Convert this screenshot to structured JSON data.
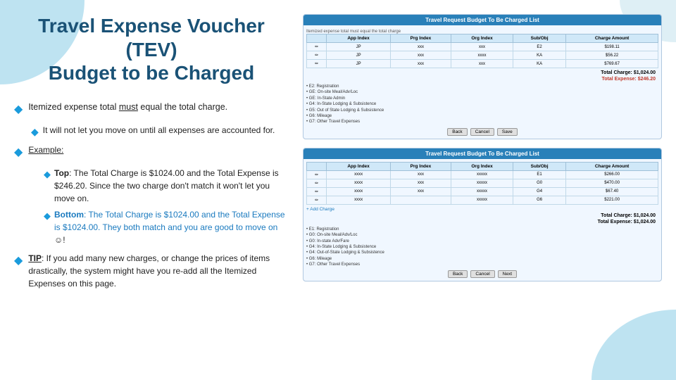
{
  "page": {
    "title_line1": "Travel Expense Voucher (TEV)",
    "title_line2": "Budget to be Charged"
  },
  "content": {
    "bullet1": "Itemized expense total must equal the total charge.",
    "sub1": "It will not let you move on until all expenses are accounted for.",
    "bullet2_label": "Example:",
    "top_label": "Top",
    "top_text": ": The Total Charge is $1024.00 and the Total Expense is $246.20.  Since the two charge don't match it won't let you move on.",
    "bottom_label": "Bottom",
    "bottom_text": ": The Total Charge is $1024.00 and the Total Expense is $1024.00.  They both match and you are good to move on",
    "smiley": "☺",
    "tip_label": "TIP",
    "tip_text": ": If you add many new charges, or change the prices of items drastically, the system might have you re-add all the Itemized Expenses on this page."
  },
  "panel_top": {
    "title": "Travel Request Budget To Be Charged List",
    "note": "Itemized expense total must equal the total charge",
    "columns": [
      "",
      "App Index",
      "Prg Index",
      "Org Index",
      "Sub/Obj",
      "Charge Amount"
    ],
    "rows": [
      [
        "✏",
        "JP",
        "xxx",
        "xxx",
        "E2",
        "$198.11"
      ],
      [
        "✏",
        "JP",
        "xxx",
        "xxxx",
        "KA",
        "$56.22"
      ],
      [
        "✏",
        "JP",
        "xxx",
        "xxx",
        "KA",
        "$769.67"
      ]
    ],
    "total_label": "Total Charge",
    "total_amount": "$1,024.00",
    "expense_label": "Total Expense:",
    "expense_amount": "$246.20",
    "legend_items": [
      "E2: Registration",
      "GE: On-site Meal/Adv/Loc",
      "GE: In-State Admin",
      "G4: In-State Lodging & Subsistence",
      "G5: Out of State Lodging & Subsistence",
      "G6: Mileage",
      "G7: Other Travel Expenses"
    ],
    "buttons": [
      "Back",
      "Cancel",
      "Save"
    ]
  },
  "panel_bottom": {
    "title": "Travel Request Budget To Be Charged List",
    "columns": [
      "",
      "App Index",
      "Prg Index",
      "Org Index",
      "Sub/Obj",
      "Charge Amount"
    ],
    "rows": [
      [
        "✏",
        "xxxx",
        "xxx",
        "xxxxx",
        "E1",
        "$266.00"
      ],
      [
        "✏",
        "xxxx",
        "xxx",
        "xxxxx",
        "G0",
        "$470.00"
      ],
      [
        "✏",
        "xxxx",
        "xxx",
        "xxxxx",
        "G4",
        "$67.40"
      ],
      [
        "✏",
        "xxxx",
        "xxxxx",
        "G6",
        "$221.00"
      ]
    ],
    "add_charge": "+ Add Charge",
    "total_label": "Total Charge:",
    "total_amount": "$1,024.00",
    "expense_label": "Total Expense:",
    "expense_amount": "$1,024.00",
    "legend_items": [
      "E1: Registration",
      "G0: On-site Meal/Adv/Loc",
      "G0: In-state Adv/Fare",
      "G4: In-State Lodging & Subsistence",
      "G4: Out-of-State Lodging & Subsistence",
      "G6: Mileage",
      "G7: Other Travel Expenses"
    ],
    "buttons": [
      "Back",
      "Cancel",
      "Next"
    ]
  }
}
